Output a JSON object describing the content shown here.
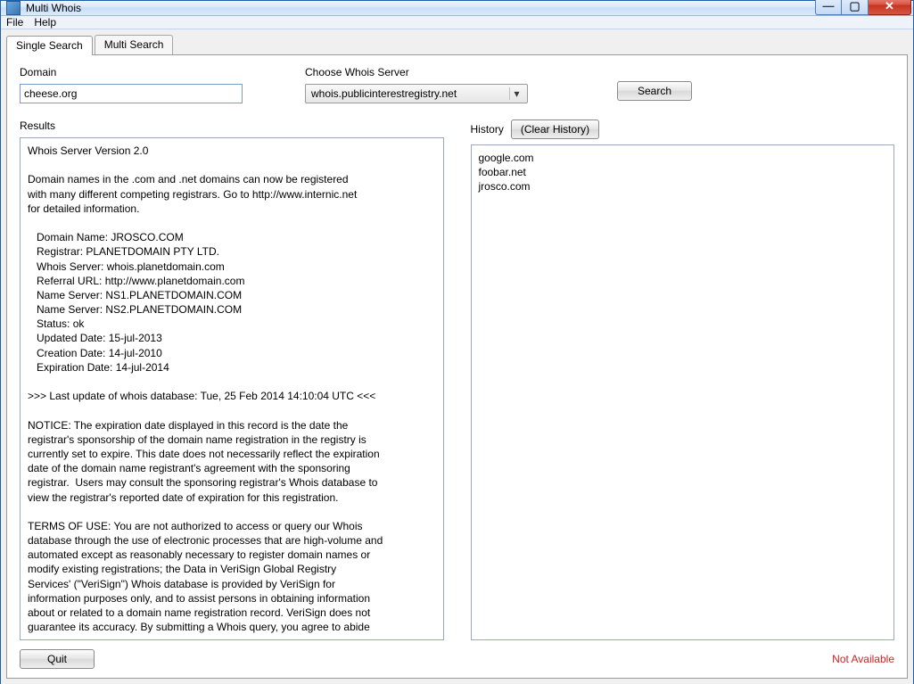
{
  "window": {
    "title": "Multi Whois"
  },
  "menu": {
    "file": "File",
    "help": "Help"
  },
  "tabs": {
    "single": "Single Search",
    "multi": "Multi Search"
  },
  "labels": {
    "domain": "Domain",
    "choose_server": "Choose Whois Server",
    "results": "Results",
    "history": "History"
  },
  "buttons": {
    "search": "Search",
    "clear_history": "(Clear History)",
    "quit": "Quit"
  },
  "inputs": {
    "domain_value": "cheese.org",
    "server_selected": "whois.publicinterestregistry.net"
  },
  "history": {
    "items": [
      "google.com",
      "foobar.net",
      "jrosco.com"
    ]
  },
  "status": {
    "text": "Not Available",
    "color": "#d42020"
  },
  "results_text": "Whois Server Version 2.0\n\nDomain names in the .com and .net domains can now be registered\nwith many different competing registrars. Go to http://www.internic.net\nfor detailed information.\n\n   Domain Name: JROSCO.COM\n   Registrar: PLANETDOMAIN PTY LTD.\n   Whois Server: whois.planetdomain.com\n   Referral URL: http://www.planetdomain.com\n   Name Server: NS1.PLANETDOMAIN.COM\n   Name Server: NS2.PLANETDOMAIN.COM\n   Status: ok\n   Updated Date: 15-jul-2013\n   Creation Date: 14-jul-2010\n   Expiration Date: 14-jul-2014\n\n>>> Last update of whois database: Tue, 25 Feb 2014 14:10:04 UTC <<<\n\nNOTICE: The expiration date displayed in this record is the date the\nregistrar's sponsorship of the domain name registration in the registry is\ncurrently set to expire. This date does not necessarily reflect the expiration\ndate of the domain name registrant's agreement with the sponsoring\nregistrar.  Users may consult the sponsoring registrar's Whois database to\nview the registrar's reported date of expiration for this registration.\n\nTERMS OF USE: You are not authorized to access or query our Whois\ndatabase through the use of electronic processes that are high-volume and\nautomated except as reasonably necessary to register domain names or\nmodify existing registrations; the Data in VeriSign Global Registry\nServices' (\"VeriSign\") Whois database is provided by VeriSign for\ninformation purposes only, and to assist persons in obtaining information\nabout or related to a domain name registration record. VeriSign does not\nguarantee its accuracy. By submitting a Whois query, you agree to abide"
}
